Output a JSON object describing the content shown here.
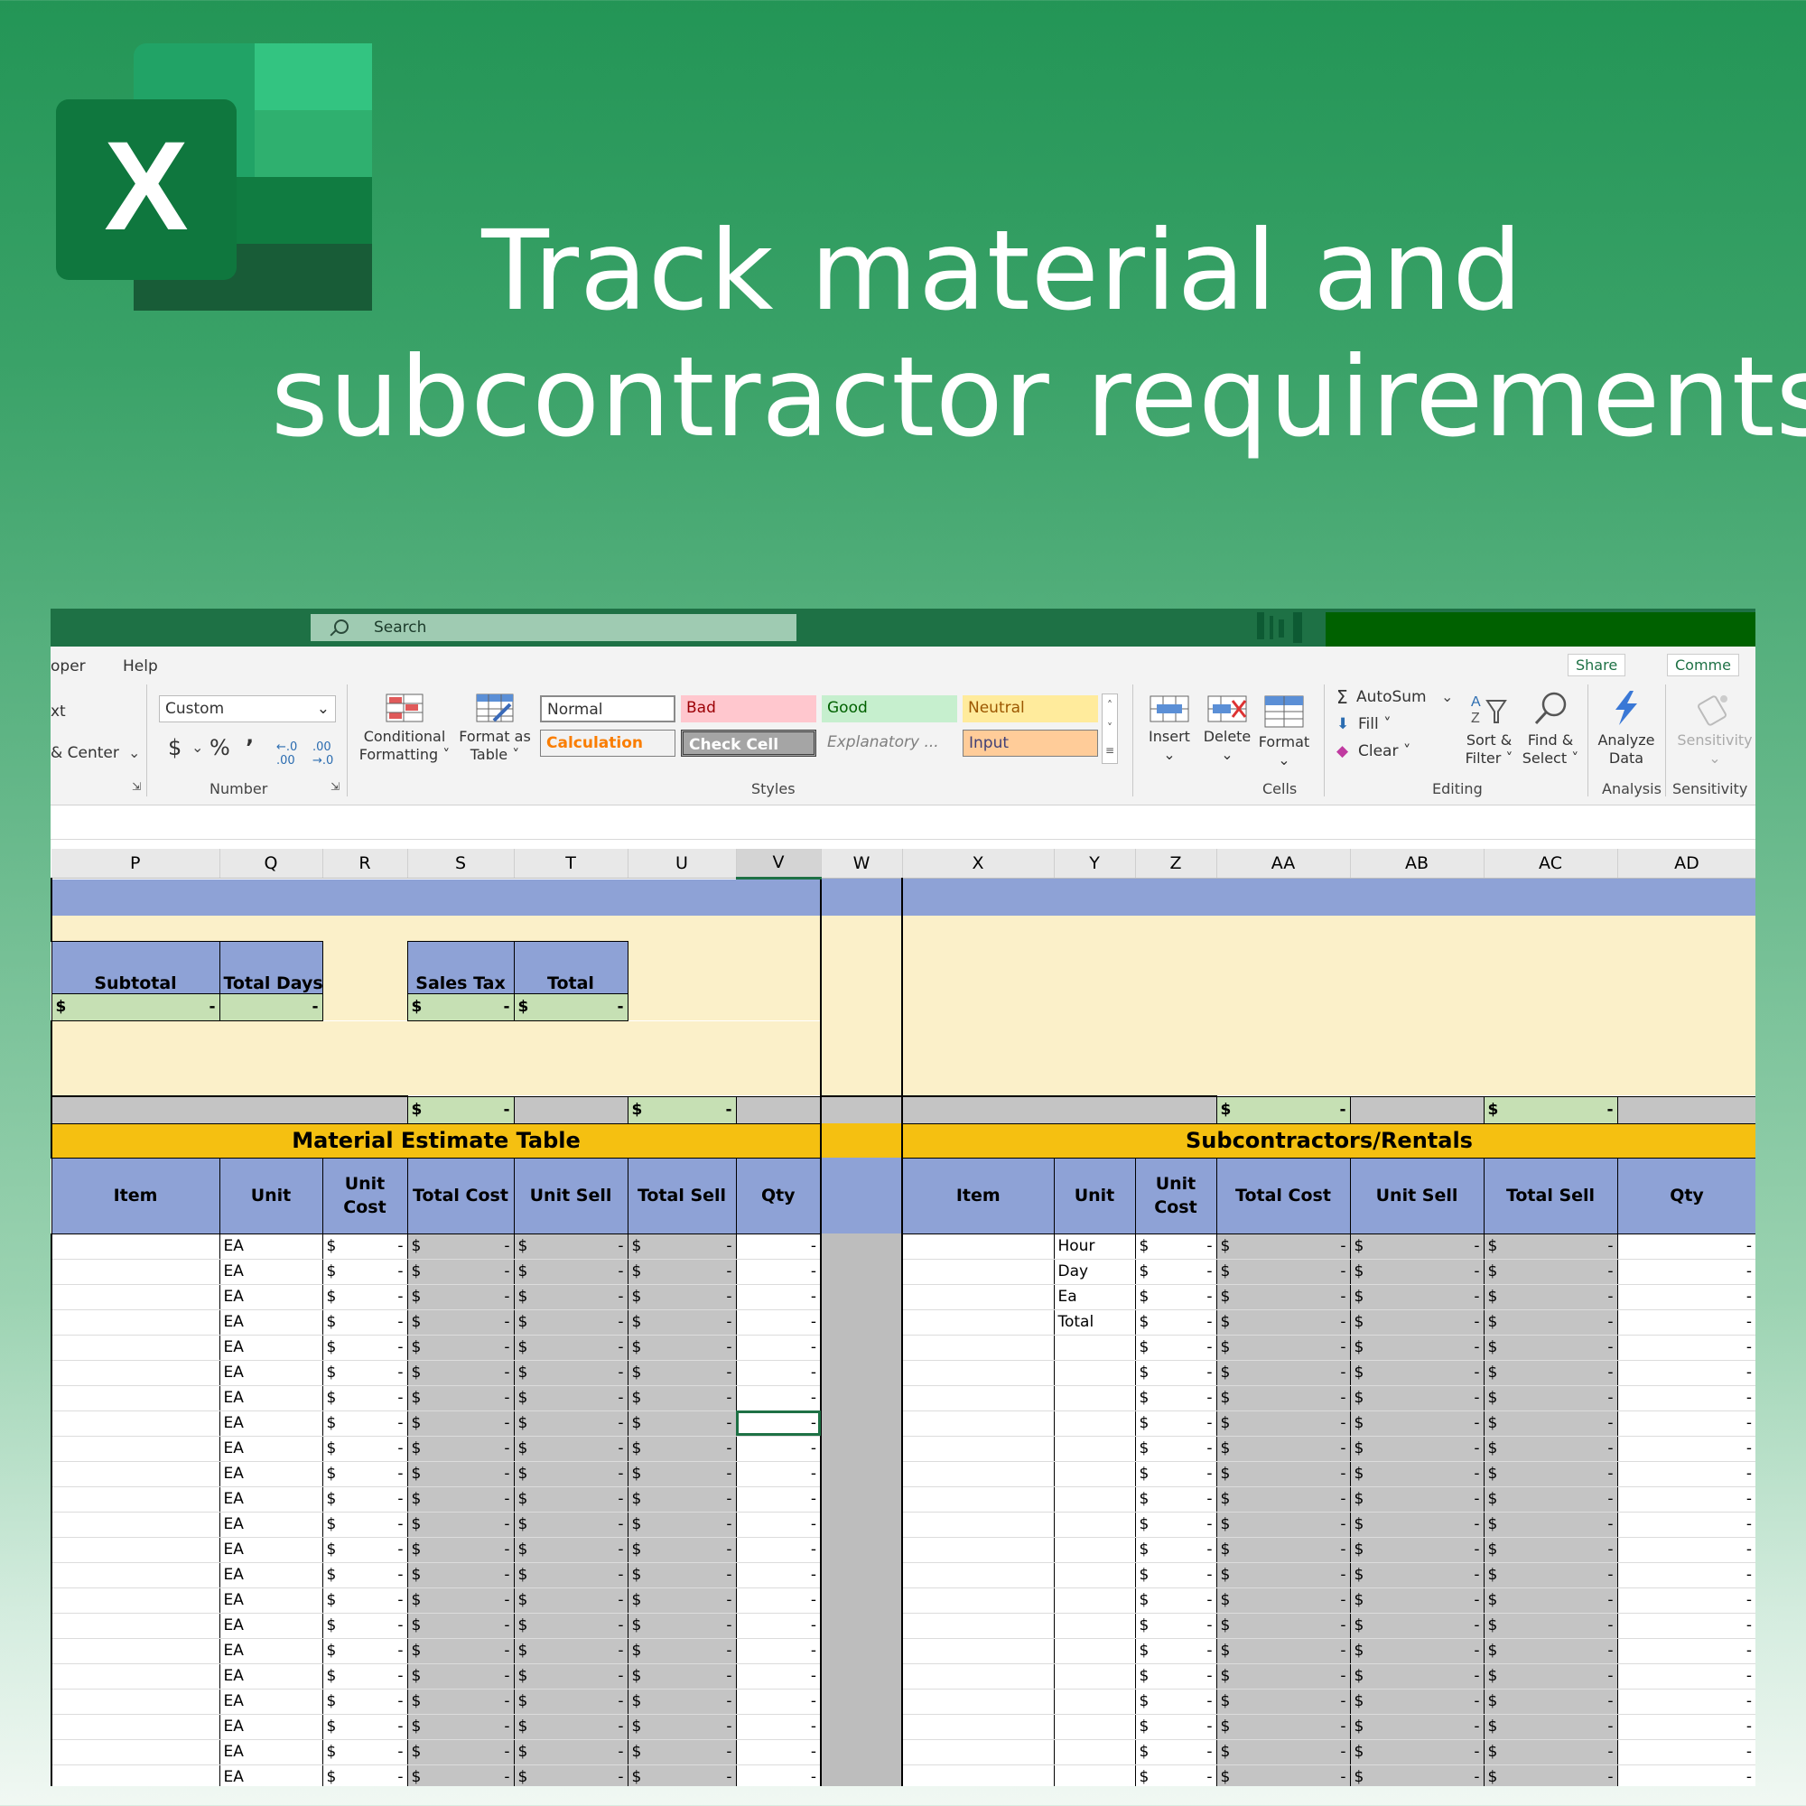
{
  "headline": {
    "line1": "Track material and",
    "line2": "subcontractor requirements"
  },
  "window": {
    "search_placeholder": "Search",
    "share_label": "Share",
    "comments_label": "Comme"
  },
  "ribbon": {
    "tabs": [
      "oper",
      "Help"
    ],
    "alignment": {
      "wrap_text": "xt",
      "merge_center": "& Center"
    },
    "number": {
      "format_value": "Custom",
      "currency": "$",
      "percent": "%",
      "comma": "’",
      "inc_decimal": "←.0 .00",
      "dec_decimal": ".00→.0",
      "group_label": "Number"
    },
    "styles": {
      "conditional_formatting": [
        "Conditional",
        "Formatting ˅"
      ],
      "format_as_table": [
        "Format as",
        "Table ˅"
      ],
      "cells": {
        "normal": "Normal",
        "bad": "Bad",
        "good": "Good",
        "neutral": "Neutral",
        "calculation": "Calculation",
        "check_cell": "Check Cell",
        "explanatory": "Explanatory ...",
        "input": "Input"
      },
      "group_label": "Styles"
    },
    "cells": {
      "insert": "Insert",
      "delete": "Delete",
      "format": "Format",
      "group_label": "Cells"
    },
    "editing": {
      "autosum": "AutoSum",
      "fill": "Fill ˅",
      "clear": "Clear ˅",
      "sort_filter": [
        "Sort &",
        "Filter ˅"
      ],
      "find_select": [
        "Find &",
        "Select ˅"
      ],
      "group_label": "Editing"
    },
    "analysis": {
      "analyze_data": [
        "Analyze",
        "Data"
      ],
      "group_label": "Analysis"
    },
    "sensitivity": {
      "label": "Sensitivity",
      "group_label": "Sensitivity"
    }
  },
  "sheet": {
    "columns": [
      "P",
      "Q",
      "R",
      "S",
      "T",
      "U",
      "V",
      "W",
      "X",
      "Y",
      "Z",
      "AA",
      "AB",
      "AC",
      "AD"
    ],
    "summary": {
      "subtotal": "Subtotal",
      "total_days": "Total Days",
      "sales_tax": "Sales Tax",
      "total": "Total",
      "dollar": "$",
      "dash": "-"
    },
    "material": {
      "title": "Material Estimate Table",
      "headers": [
        "Item",
        "Unit",
        "Unit Cost",
        "Total Cost",
        "Unit Sell",
        "Total Sell",
        "Qty"
      ],
      "unit_value": "EA",
      "row_count": 22
    },
    "subcontractors": {
      "title": "Subcontractors/Rentals",
      "headers": [
        "Item",
        "Unit",
        "Unit Cost",
        "Total Cost",
        "Unit Sell",
        "Total Sell",
        "Qty"
      ],
      "units": [
        "Hour",
        "Day",
        "Ea",
        "Total"
      ],
      "row_count": 22
    },
    "colors": {
      "header_blue": "#8ea2d6",
      "cream": "#fbf0c9",
      "gold": "#f5c011",
      "input_green": "#c6e0b4",
      "calc_gray": "#c4c4c4",
      "excel_green": "#1e7145"
    }
  }
}
